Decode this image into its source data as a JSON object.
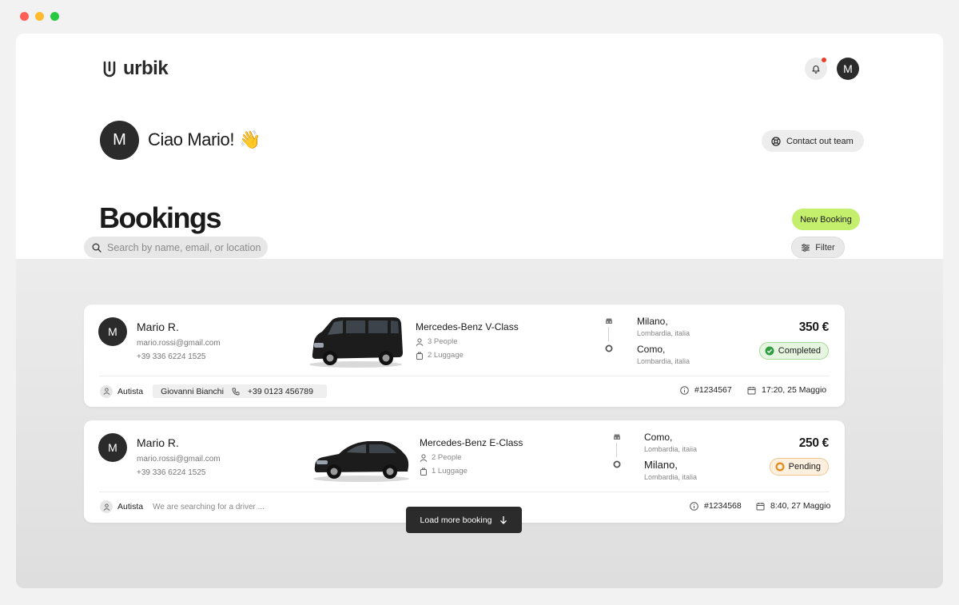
{
  "window": {
    "dot_colors": [
      "#ff5f57",
      "#febc2e",
      "#28c840"
    ]
  },
  "header": {
    "brand": "urbik",
    "avatar_initial": "M"
  },
  "greeting": {
    "avatar_initial": "M",
    "text": "Ciao Mario!",
    "emoji": "👋"
  },
  "contact_button": {
    "label": "Contact out team"
  },
  "page_title": "Bookings",
  "new_booking_button": {
    "label": "New Booking",
    "color": "#c4ef6c"
  },
  "search": {
    "placeholder": "Search by name, email, or location"
  },
  "filter_button": {
    "label": "Filter"
  },
  "bookings": [
    {
      "avatar_initial": "M",
      "name": "Mario R.",
      "email": "mario.rossi@gmail.com",
      "phone": "+39 336 6224 1525",
      "car_model": "Mercedes-Benz V-Class",
      "people": "3 People",
      "luggage": "2 Luggage",
      "from_city": "Milano,",
      "from_region": "Lombardia, italia",
      "to_city": "Como,",
      "to_region": "Lombardia, italia",
      "price": "350 €",
      "status": "Completed",
      "status_color": "#2e9e3e",
      "driver_label": "Autista",
      "driver_name": "Giovanni Bianchi",
      "driver_phone": "+39 0123 456789",
      "booking_id": "#1234567",
      "datetime": "17:20, 25 Maggio"
    },
    {
      "avatar_initial": "M",
      "name": "Mario R.",
      "email": "mario.rossi@gmail.com",
      "phone": "+39 336 6224 1525",
      "car_model": "Mercedes-Benz E-Class",
      "people": "2 People",
      "luggage": "1 Luggage",
      "from_city": "Como,",
      "from_region": "Lombardia, itaiia",
      "to_city": "Milano,",
      "to_region": "Lombardia, italia",
      "price": "250 €",
      "status": "Pending",
      "status_color": "#e58a13",
      "driver_label": "Autista",
      "driver_status": "We are searching for a driver ...",
      "booking_id": "#1234568",
      "datetime": "8:40, 27 Maggio"
    }
  ],
  "load_more_button": {
    "label": "Load more booking"
  }
}
